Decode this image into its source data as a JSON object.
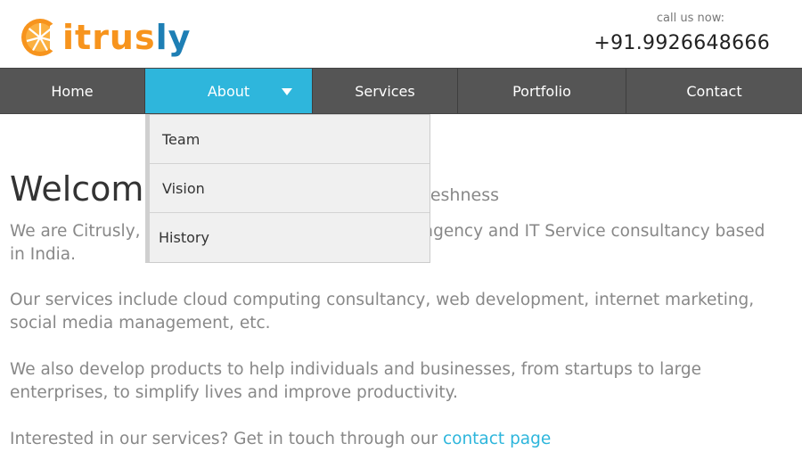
{
  "brand": {
    "logo_initial": "C",
    "logo_rest_part1": "itrus",
    "logo_rest_part2": "ly",
    "color_orange": "#f7941d",
    "color_blue": "#1e7fb5"
  },
  "header": {
    "call_label": "call us now:",
    "phone": "+91.9926648666"
  },
  "nav": {
    "items": [
      {
        "label": "Home"
      },
      {
        "label": "About"
      },
      {
        "label": "Services"
      },
      {
        "label": "Portfolio"
      },
      {
        "label": "Contact"
      }
    ],
    "active_color": "#2eb6dc"
  },
  "dropdown": {
    "items": [
      {
        "label": "Team"
      },
      {
        "label": "Vision"
      },
      {
        "label": "History"
      }
    ]
  },
  "content": {
    "welcome_visible": "Welcome",
    "welcome_sub_visible": "eshness",
    "p1_before": "We are Citrusly, a",
    "p1_after": "agency and IT Service consultancy based in India.",
    "p2": "Our services include cloud computing consultancy, web development, internet marketing, social media management, etc.",
    "p3": "We also develop products to help individuals and businesses, from startups to large enterprises, to simplify lives and improve productivity.",
    "p4_text": "Interested in our services? Get in touch through our ",
    "p4_link": "contact page"
  }
}
